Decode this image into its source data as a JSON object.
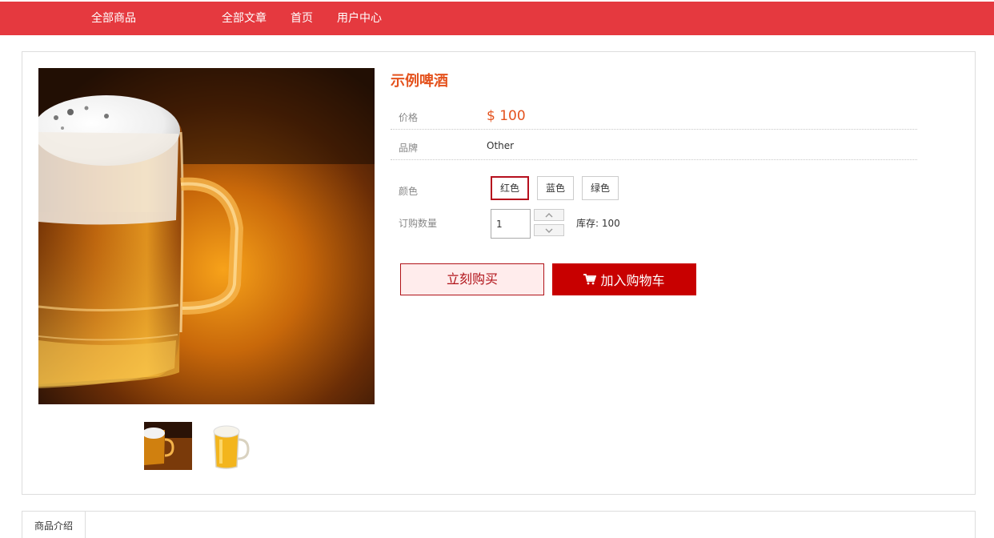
{
  "nav": {
    "items": [
      {
        "label": "全部商品"
      },
      {
        "label": "全部文章"
      },
      {
        "label": "首页"
      },
      {
        "label": "用户中心"
      }
    ]
  },
  "product": {
    "title": "示例啤酒",
    "price_label": "价格",
    "price": "$ 100",
    "brand_label": "品牌",
    "brand": "Other",
    "color_label": "颜色",
    "colors": [
      "红色",
      "蓝色",
      "绿色"
    ],
    "selected_color": "红色",
    "qty_label": "订购数量",
    "qty_value": "1",
    "stock_label": "库存:",
    "stock_value": "100",
    "buy_now": "立刻购买",
    "add_to_cart": "加入购物车"
  },
  "tabs": {
    "items": [
      {
        "label": "商品介绍"
      }
    ]
  },
  "colors": {
    "nav_bg": "#e5393f",
    "accent": "#e4521d",
    "cart_button": "#c80000",
    "buy_border": "#b01218"
  },
  "icons": {
    "cart": "cart-icon",
    "up": "chevron-up-icon",
    "down": "chevron-down-icon"
  }
}
